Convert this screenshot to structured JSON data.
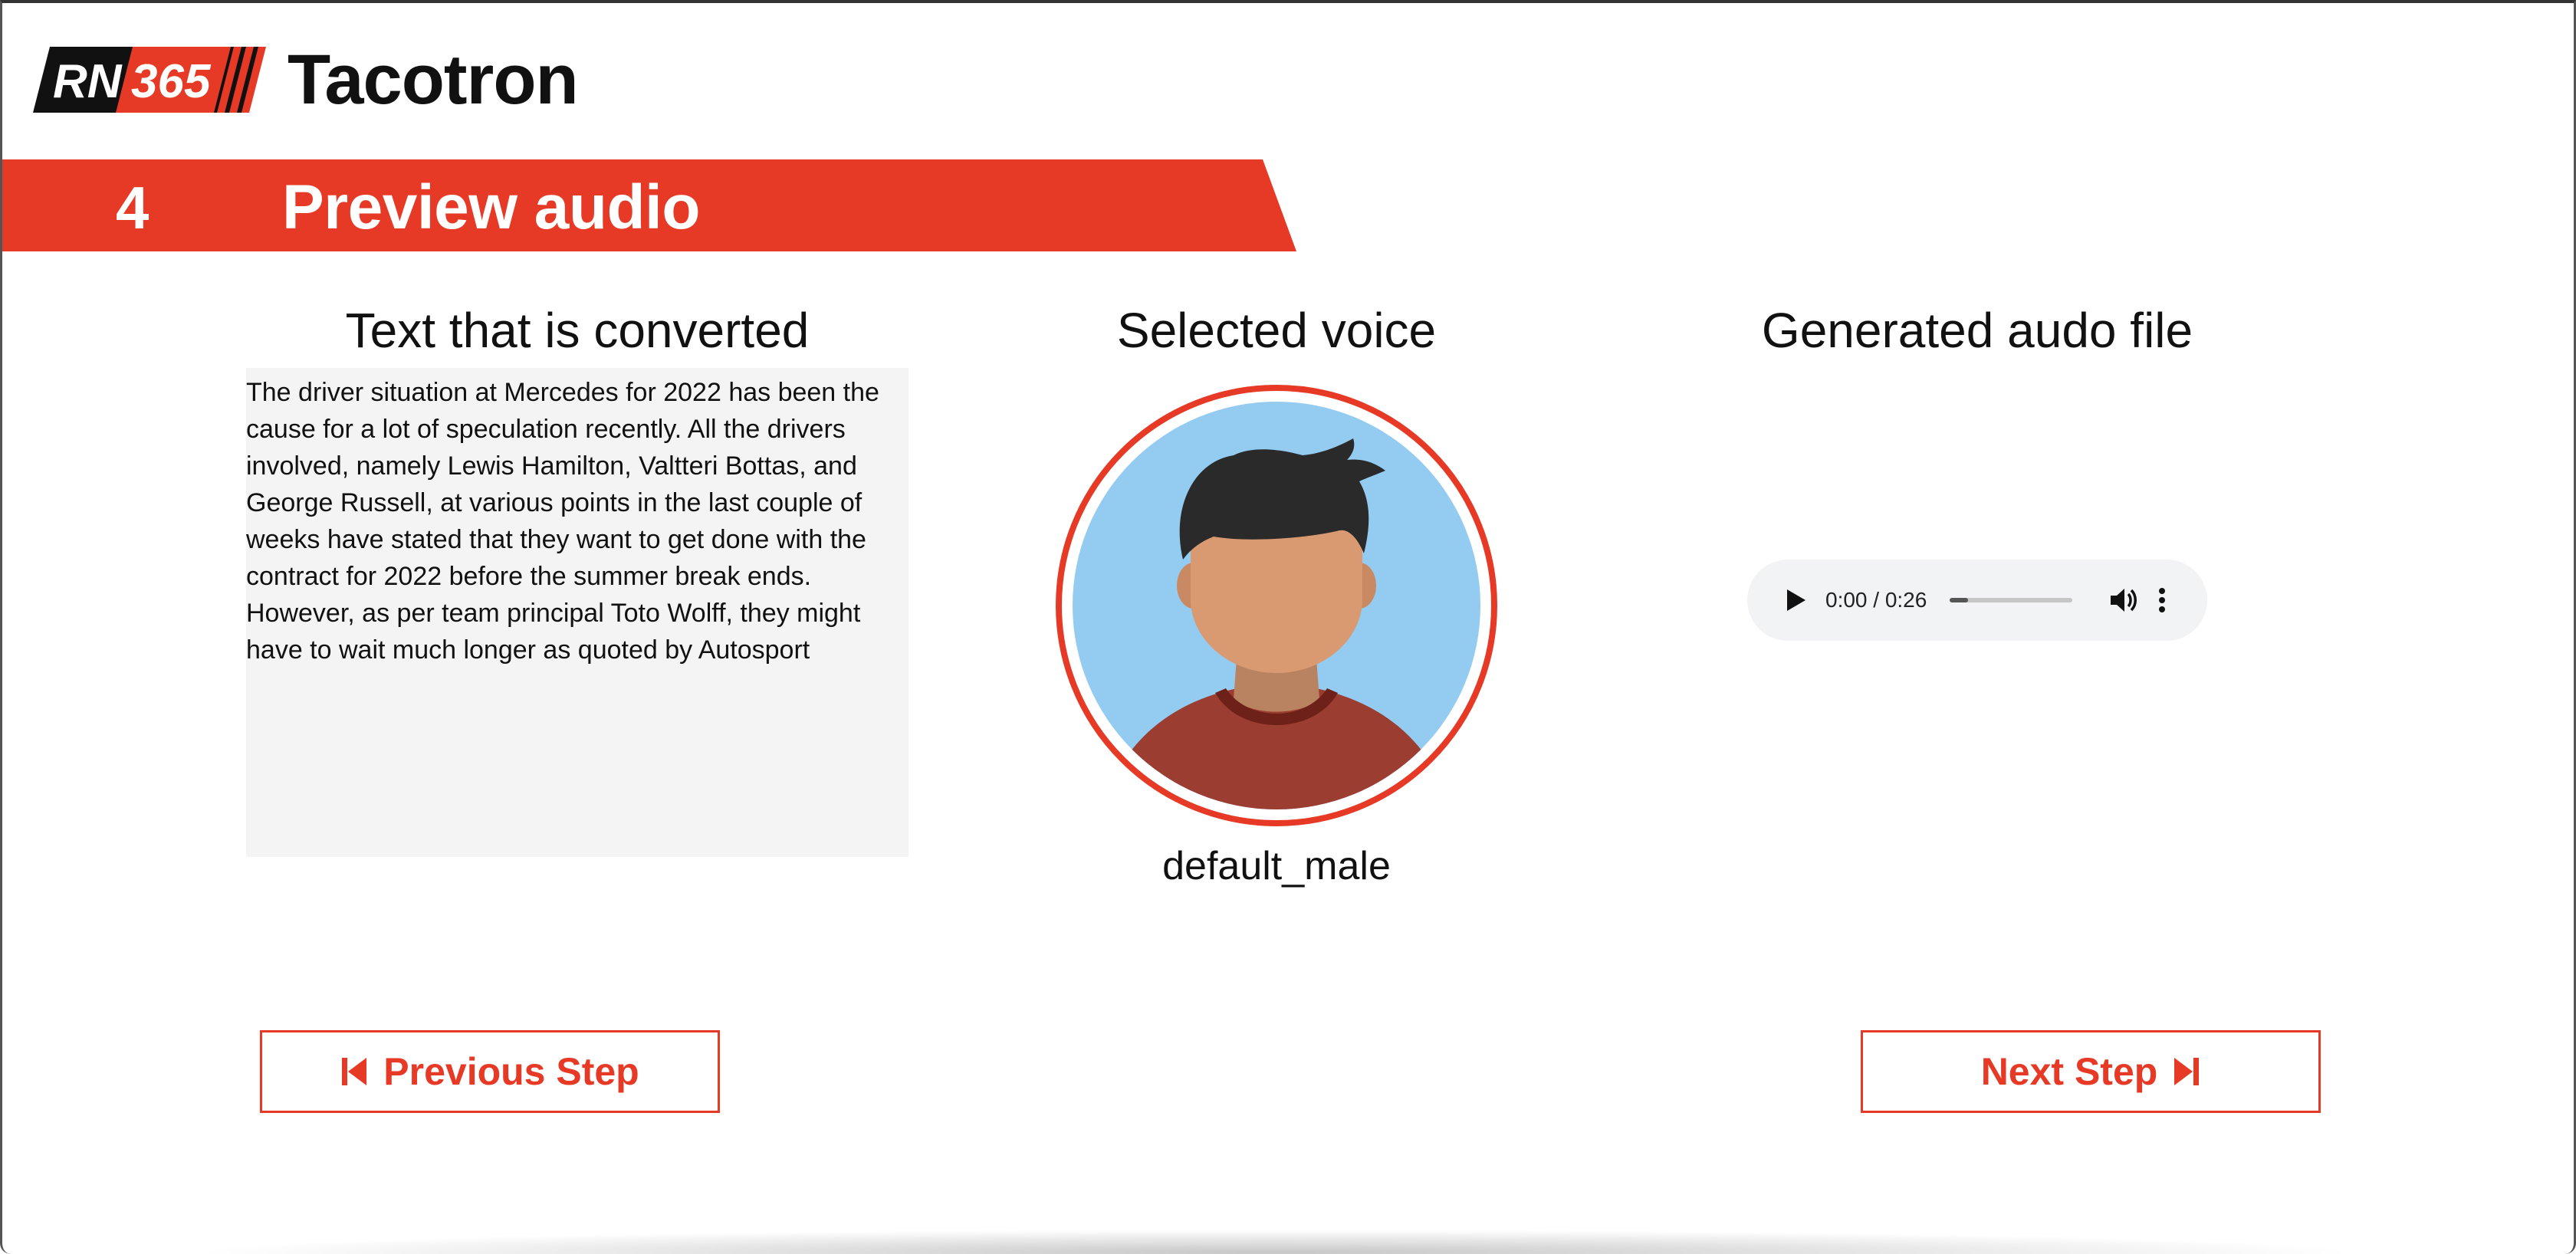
{
  "header": {
    "logo_text_left": "RN",
    "logo_text_right": "365",
    "app_title": "Tacotron"
  },
  "step": {
    "number": "4",
    "title": "Preview audio"
  },
  "columns": {
    "text_title": "Text that is converted",
    "voice_title": "Selected voice",
    "audio_title": "Generated audo file"
  },
  "text_lines": [
    "The driver situation at Mercedes for 2022 has been the",
    "cause for a lot of speculation recently. All the drivers",
    "involved, namely Lewis Hamilton, Valtteri Bottas, and",
    "George Russell, at various points in the last couple of",
    "weeks have stated that they want to get done with the",
    "contract for 2022 before the summer break ends.",
    "However, as per team principal Toto Wolff, they might",
    "have to wait much longer as quoted by Autosport"
  ],
  "voice": {
    "name": "default_male",
    "avatar_icon": "male-avatar-icon"
  },
  "audio": {
    "time": "0:00 / 0:26",
    "progress_fraction": 0.0,
    "play_icon": "play-icon",
    "volume_icon": "volume-icon",
    "more_icon": "more-vertical-icon"
  },
  "buttons": {
    "previous_label": "Previous Step",
    "next_label": "Next Step",
    "previous_icon": "skip-previous-icon",
    "next_icon": "skip-next-icon"
  },
  "colors": {
    "accent": "#e63a26",
    "avatar_bg": "#93cbf1",
    "shirt": "#9b3d30",
    "skin": "#d99a71",
    "hair": "#2a2a2a"
  }
}
